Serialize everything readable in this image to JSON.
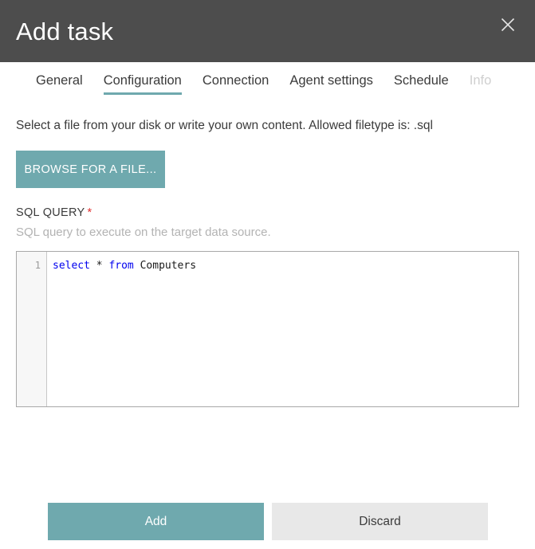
{
  "header": {
    "title": "Add task",
    "close_icon": "close-icon",
    "background": "#4d4d4d"
  },
  "tabs": [
    {
      "label": "General",
      "state": "normal"
    },
    {
      "label": "Configuration",
      "state": "active"
    },
    {
      "label": "Connection",
      "state": "normal"
    },
    {
      "label": "Agent settings",
      "state": "normal"
    },
    {
      "label": "Schedule",
      "state": "normal"
    },
    {
      "label": "Info",
      "state": "disabled"
    }
  ],
  "main": {
    "intro_text": "Select a file from your disk or write your own content. Allowed filetype is: .sql",
    "browse_button_label": "BROWSE FOR A FILE...",
    "field": {
      "label": "SQL QUERY",
      "required_marker": "*",
      "help_text": "SQL query to execute on the target data source."
    },
    "editor": {
      "line_numbers": [
        "1"
      ],
      "value": "select * from Computers",
      "tokens": [
        {
          "text": "select",
          "type": "keyword"
        },
        {
          "text": " ",
          "type": "plain"
        },
        {
          "text": "*",
          "type": "operator"
        },
        {
          "text": " ",
          "type": "plain"
        },
        {
          "text": "from",
          "type": "keyword"
        },
        {
          "text": " Computers",
          "type": "plain"
        }
      ]
    }
  },
  "footer": {
    "primary_label": "Add",
    "secondary_label": "Discard"
  },
  "colors": {
    "accent": "#6fa9ae",
    "header_bg": "#4d4d4d",
    "secondary_btn_bg": "#e8e8e8",
    "required_star": "#e03030",
    "keyword": "#0000ee",
    "muted_text": "#b3b3b3",
    "disabled_tab": "#cfcfcf"
  }
}
